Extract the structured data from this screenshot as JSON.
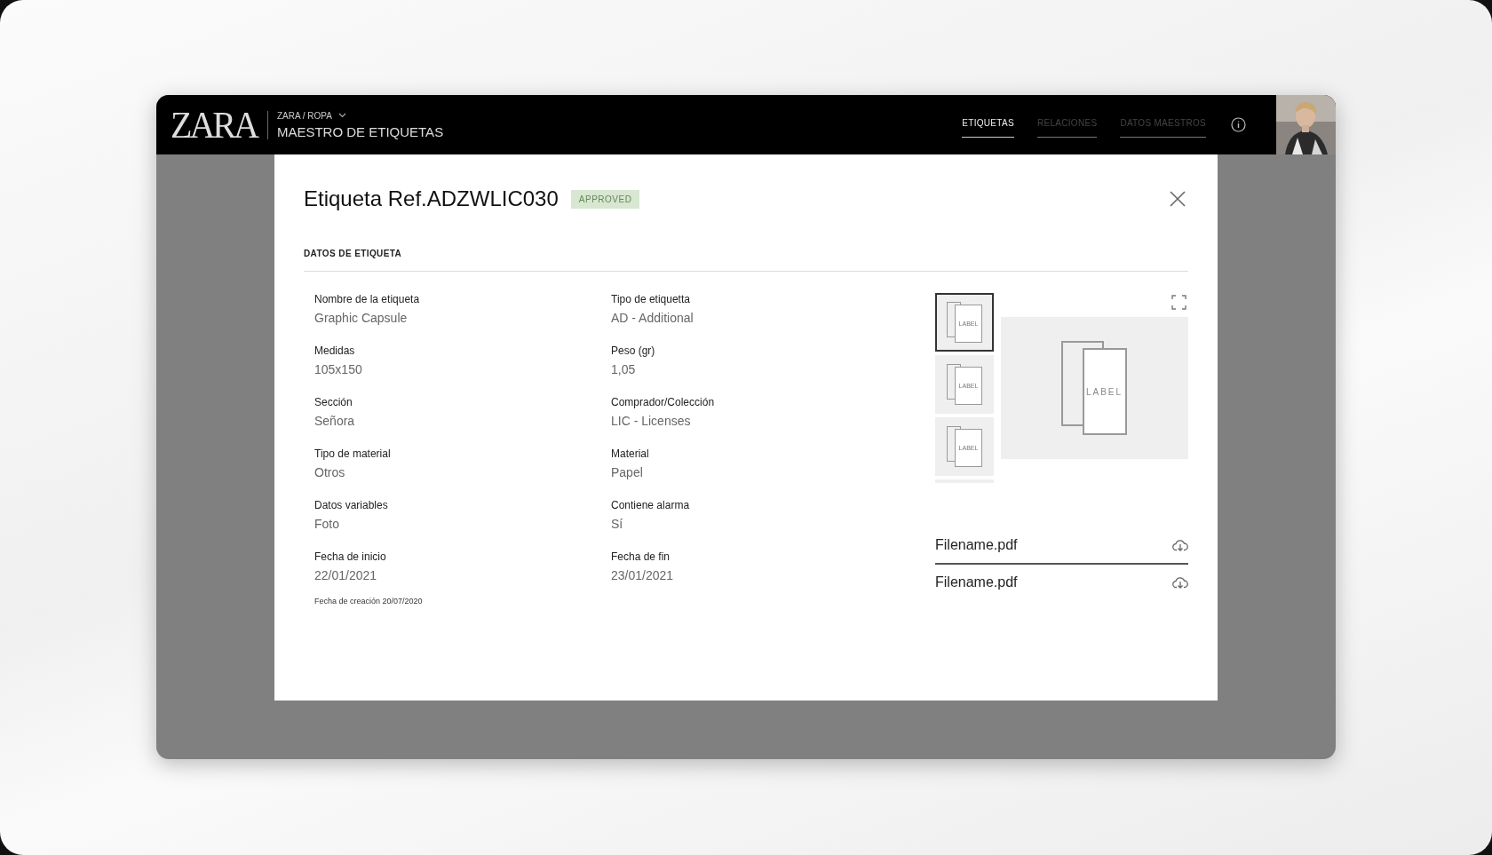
{
  "header": {
    "logo": "ZARA",
    "breadcrumb": "ZARA / ROPA",
    "title": "MAESTRO DE ETIQUETAS",
    "tabs": [
      {
        "label": "ETIQUETAS",
        "selected": true
      },
      {
        "label": "RELACIONES",
        "selected": false
      },
      {
        "label": "DATOS MAESTROS",
        "selected": false
      }
    ]
  },
  "modal": {
    "title": "Etiqueta Ref.ADZWLIC030",
    "status": "APPROVED",
    "section": "DATOS DE ETIQUETA",
    "fields": [
      {
        "label": "Nombre de la etiqueta",
        "value": "Graphic Capsule"
      },
      {
        "label": "Tipo de etiquetta",
        "value": "AD - Additional"
      },
      {
        "label": "Medidas",
        "value": "105x150"
      },
      {
        "label": "Peso (gr)",
        "value": "1,05"
      },
      {
        "label": "Sección",
        "value": "Señora"
      },
      {
        "label": "Comprador/Colección",
        "value": "LIC - Licenses"
      },
      {
        "label": "Tipo de material",
        "value": "Otros"
      },
      {
        "label": "Material",
        "value": "Papel"
      },
      {
        "label": "Datos variables",
        "value": "Foto"
      },
      {
        "label": "Contiene alarma",
        "value": "Sí"
      },
      {
        "label": "Fecha de inicio",
        "value": "22/01/2021"
      },
      {
        "label": "Fecha de fin",
        "value": "23/01/2021"
      }
    ],
    "created": "Fecha de creación 20/07/2020",
    "thumbnails": [
      {
        "label": "LABEL",
        "selected": true
      },
      {
        "label": "LABEL",
        "selected": false
      },
      {
        "label": "LABEL",
        "selected": false
      }
    ],
    "preview_label": "LABEL",
    "files": [
      "Filename.pdf",
      "Filename.pdf"
    ]
  }
}
